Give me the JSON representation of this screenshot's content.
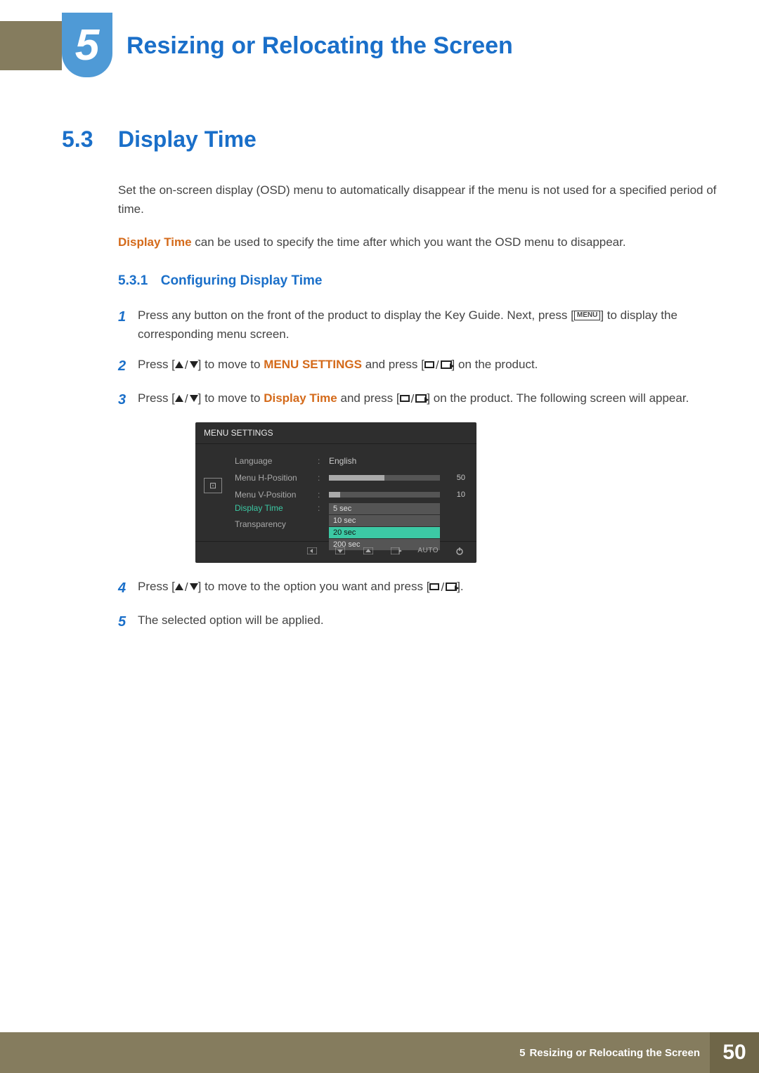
{
  "chapter": {
    "number": "5",
    "title": "Resizing or Relocating the Screen"
  },
  "section": {
    "number": "5.3",
    "title": "Display Time",
    "intro1": "Set the on-screen display (OSD) menu to automatically disappear if the menu is not used for a specified period of time.",
    "intro2_hi": "Display Time",
    "intro2_rest": " can be used to specify the time after which you want the OSD menu to disappear."
  },
  "subsection": {
    "number": "5.3.1",
    "title": "Configuring Display Time"
  },
  "steps": [
    {
      "n": "1",
      "pre": "Press any button on the front of the product to display the Key Guide. Next, press [",
      "menu_key": "MENU",
      "post": "] to display the corresponding menu screen."
    },
    {
      "n": "2",
      "pre": "Press [",
      "mid": "] to move to ",
      "hi": "MENU SETTINGS",
      "after_hi": " and press [",
      "post": "] on the product."
    },
    {
      "n": "3",
      "pre": "Press [",
      "mid": "] to move to ",
      "hi": "Display Time",
      "after_hi": " and press [",
      "post": "] on the product. The following screen will appear."
    },
    {
      "n": "4",
      "pre": "Press [",
      "mid": "] to move to the option you want and press [",
      "post": "]."
    },
    {
      "n": "5",
      "text": "The selected option will be applied."
    }
  ],
  "osd": {
    "title": "MENU SETTINGS",
    "rows": {
      "language": {
        "label": "Language",
        "value": "English"
      },
      "hpos": {
        "label": "Menu H-Position",
        "value": 50,
        "pct": 50
      },
      "vpos": {
        "label": "Menu V-Position",
        "value": 10,
        "pct": 10
      },
      "display_time": {
        "label": "Display Time"
      },
      "transparency": {
        "label": "Transparency"
      }
    },
    "options": [
      "5 sec",
      "10 sec",
      "20 sec",
      "200 sec"
    ],
    "selected_option_index": 2,
    "footer_auto": "AUTO"
  },
  "footer": {
    "chapter_num": "5",
    "chapter_title": "Resizing or Relocating the Screen",
    "page": "50"
  }
}
